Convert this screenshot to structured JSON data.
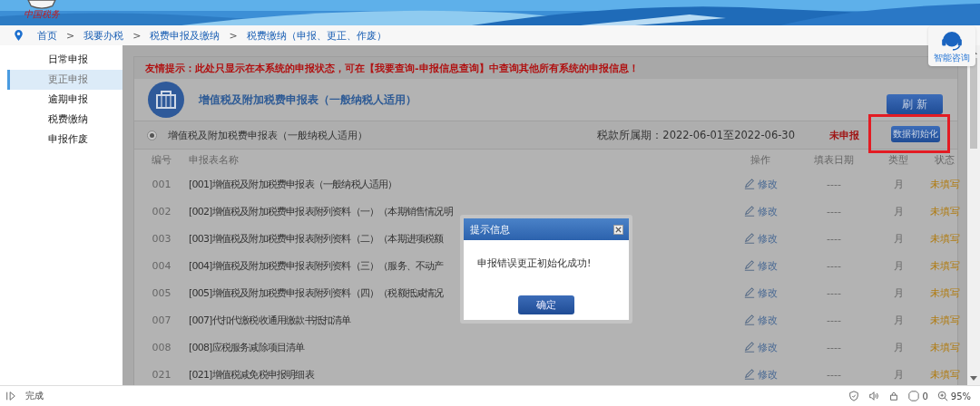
{
  "header": {
    "logo_text": "中国税务"
  },
  "breadcrumb": [
    {
      "label": "首页"
    },
    {
      "separator": ">",
      "label": "我要办税"
    },
    {
      "separator": ">",
      "label": "税费申报及缴纳"
    },
    {
      "separator": ">",
      "label": "税费缴纳（申报、更正、作废）"
    }
  ],
  "help": {
    "label": "智能咨询"
  },
  "sidebar": {
    "items": [
      {
        "label": "日常申报",
        "selected": false
      },
      {
        "label": "更正申报",
        "selected": true
      },
      {
        "label": "逾期申报",
        "selected": false
      },
      {
        "label": "税费缴纳",
        "selected": false
      },
      {
        "label": "申报作废",
        "selected": false
      }
    ]
  },
  "notice": "友情提示：此处只显示在本系统的申报状态，可在【我要查询-申报信息查询】中查询其他所有系统的申报信息！",
  "form_header": {
    "title": "增值税及附加税费申报表（一般纳税人适用）",
    "refresh_button": "刷 新"
  },
  "declaration": {
    "name": "增值税及附加税费申报表（一般纳税人适用）",
    "selected": true,
    "period": "税款所属期：2022-06-01至2022-06-30",
    "status": "未申报",
    "init_button": "数据初始化",
    "highlighted": true
  },
  "table": {
    "columns": [
      "编号",
      "申报表名称",
      "操作",
      "填表日期",
      "类型",
      "状态"
    ],
    "rows": [
      {
        "number": "001",
        "name": "[001]增值税及附加税费申报表（一般纳税人适用）",
        "action": "修改",
        "date": "----",
        "type": "月",
        "status": "未填写"
      },
      {
        "number": "002",
        "name": "[002]增值税及附加税费申报表附列资料（一）（本期销售情况明",
        "action": "修改",
        "date": "----",
        "type": "月",
        "status": "未填写"
      },
      {
        "number": "003",
        "name": "[003]增值税及附加税费申报表附列资料（二）（本期进项税额",
        "action": "修改",
        "date": "----",
        "type": "月",
        "status": "未填写"
      },
      {
        "number": "004",
        "name": "[004]增值税及附加税费申报表附列资料（三）（服务、不动产",
        "action": "修改",
        "date": "----",
        "type": "月",
        "status": "未填写"
      },
      {
        "number": "005",
        "name": "[005]增值税及附加税费申报表附列资料（四）（税额抵减情况",
        "action": "修改",
        "date": "----",
        "type": "月",
        "status": "未填写"
      },
      {
        "number": "007",
        "name": "[007]代扣代缴税收通用缴款书抵扣清单",
        "action": "修改",
        "date": "----",
        "type": "月",
        "status": "未填写"
      },
      {
        "number": "008",
        "name": "[008]应税服务减除项目清单",
        "action": "修改",
        "date": "----",
        "type": "月",
        "status": "未填写"
      },
      {
        "number": "021",
        "name": "[021]增值税减免税申报明细表",
        "action": "修改",
        "date": "----",
        "type": "月",
        "status": "未填写"
      }
    ]
  },
  "dialog": {
    "title": "提示信息",
    "message": "申报错误更正初始化成功!",
    "ok_button": "确定"
  },
  "status_bar": {
    "text": "完成",
    "badge_count": "0",
    "zoom": "95%"
  }
}
